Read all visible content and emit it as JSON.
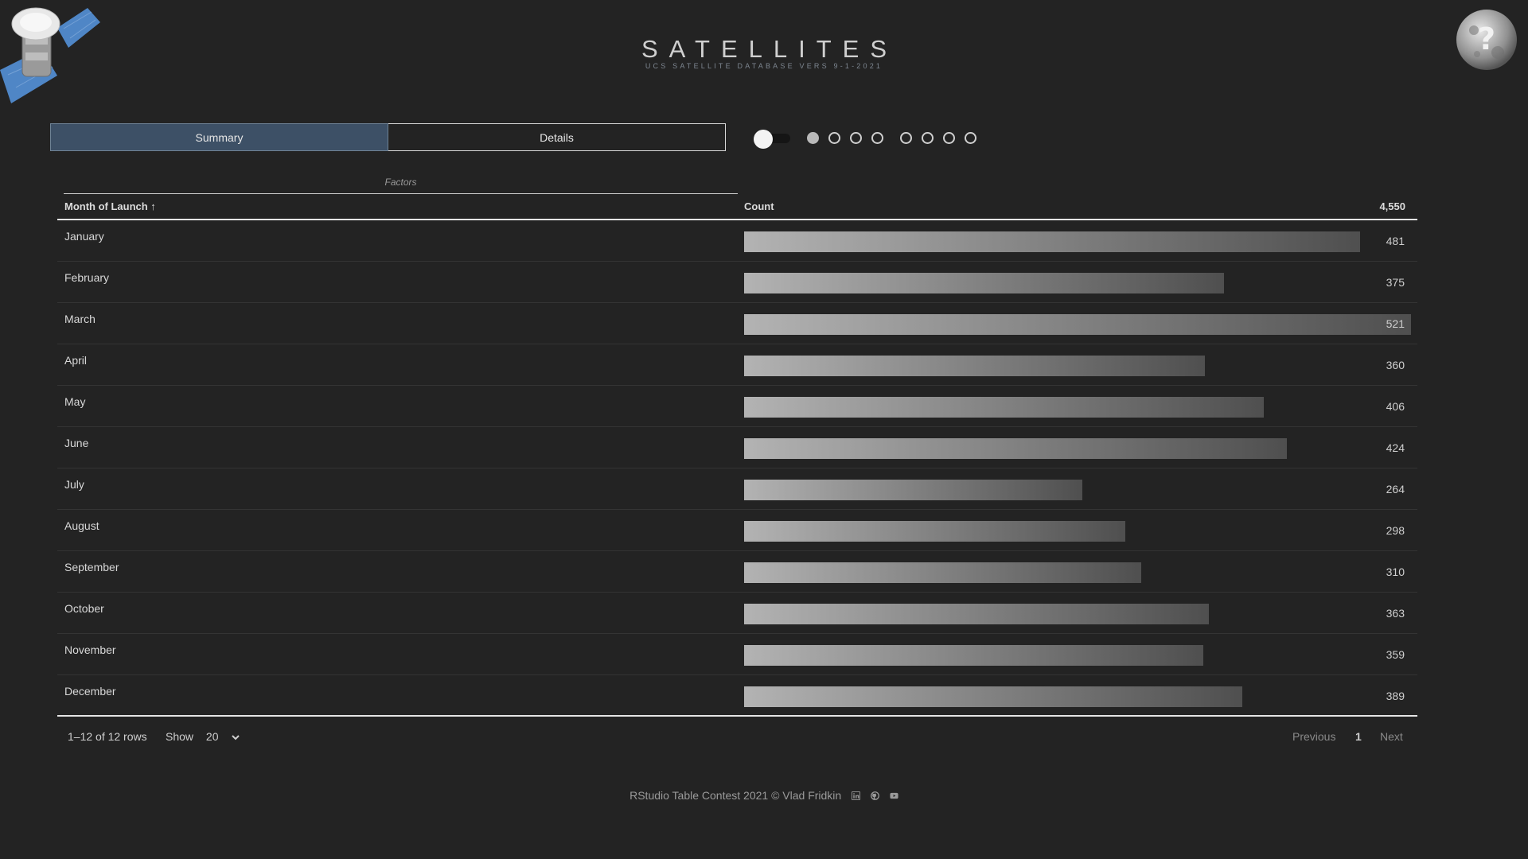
{
  "header": {
    "title": "SATELLITES",
    "subtitle": "UCS SATELLITE DATABASE VERS 9-1-2021"
  },
  "tabs": [
    {
      "label": "Summary",
      "active": true
    },
    {
      "label": "Details",
      "active": false
    }
  ],
  "controls": {
    "toggle_on": false,
    "dots_filled": [
      true,
      false,
      false,
      false,
      false,
      false,
      false,
      false
    ]
  },
  "table": {
    "group_header": "Factors",
    "col_month": "Month of Launch ↑",
    "col_count": "Count",
    "total": "4,550",
    "max_count": 521,
    "rows": [
      {
        "month": "January",
        "count": 481
      },
      {
        "month": "February",
        "count": 375
      },
      {
        "month": "March",
        "count": 521
      },
      {
        "month": "April",
        "count": 360
      },
      {
        "month": "May",
        "count": 406
      },
      {
        "month": "June",
        "count": 424
      },
      {
        "month": "July",
        "count": 264
      },
      {
        "month": "August",
        "count": 298
      },
      {
        "month": "September",
        "count": 310
      },
      {
        "month": "October",
        "count": 363
      },
      {
        "month": "November",
        "count": 359
      },
      {
        "month": "December",
        "count": 389
      }
    ]
  },
  "pager": {
    "range": "1–12 of 12 rows",
    "show_label": "Show",
    "show_value": "20",
    "previous": "Previous",
    "page": "1",
    "next": "Next"
  },
  "footer": {
    "credits": "RStudio Table Contest 2021 © Vlad Fridkin",
    "icons": [
      "linkedin-icon",
      "github-icon",
      "youtube-icon"
    ]
  },
  "colors": {
    "background": "#232323",
    "active_tab": "#3d5066"
  }
}
